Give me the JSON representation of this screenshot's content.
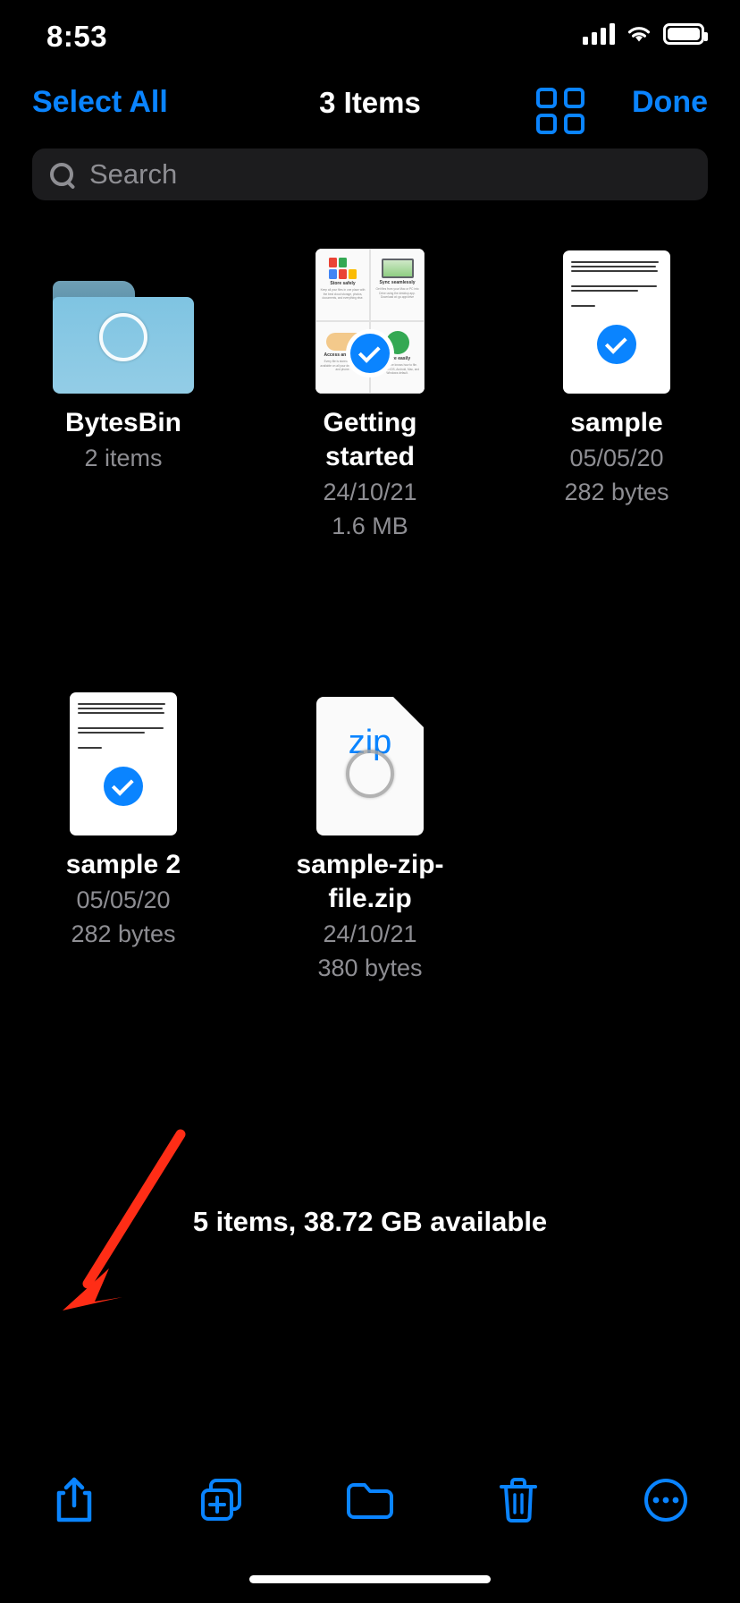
{
  "status_bar": {
    "time": "8:53",
    "cellular_icon": "signal-bars-icon",
    "wifi_icon": "wifi-icon",
    "battery_icon": "battery-icon"
  },
  "nav_bar": {
    "select_all_label": "Select All",
    "title": "3 Items",
    "grid_view_icon": "grid-view-icon",
    "done_label": "Done"
  },
  "search": {
    "placeholder": "Search",
    "value": "",
    "icon": "search-icon"
  },
  "files": [
    {
      "name": "BytesBin",
      "meta": [
        "2 items"
      ],
      "kind": "folder",
      "selected": false
    },
    {
      "name": "Getting started",
      "meta": [
        "24/10/21",
        "1.6 MB"
      ],
      "kind": "pdf",
      "selected": true,
      "preview": {
        "panels": [
          {
            "title": "Store safely",
            "subtitle": "Keep all your files in one place with the best cloud storage, photos, documents, and everything else."
          },
          {
            "title": "Sync seamlessly",
            "subtitle": "Get files from your Mac or PC into Drive using the desktop app. Download at: go.app/drive"
          },
          {
            "title": "Access anywhere",
            "subtitle": "Every file is stored online and available on all your devices, tablet, and phone."
          },
          {
            "title": "Share easily",
            "subtitle": "Then anyone knows how to file. Works with iOS, Android, Mac, and Windows default."
          }
        ]
      }
    },
    {
      "name": "sample",
      "meta": [
        "05/05/20",
        "282 bytes"
      ],
      "kind": "document",
      "selected": true
    },
    {
      "name": "sample 2",
      "meta": [
        "05/05/20",
        "282 bytes"
      ],
      "kind": "document",
      "selected": true
    },
    {
      "name": "sample-zip-file.zip",
      "meta": [
        "24/10/21",
        "380 bytes"
      ],
      "kind": "zip",
      "zip_label": "zip",
      "selected": false
    }
  ],
  "status_line": "5 items, 38.72 GB available",
  "toolbar": [
    {
      "name": "share-button",
      "icon": "share-icon"
    },
    {
      "name": "new-folder-button",
      "icon": "add-document-icon"
    },
    {
      "name": "folder-button",
      "icon": "folder-icon"
    },
    {
      "name": "delete-button",
      "icon": "trash-icon"
    },
    {
      "name": "more-button",
      "icon": "ellipsis-circle-icon"
    }
  ],
  "annotation": {
    "arrow_color": "#ff2d16",
    "points_to": "share-button"
  },
  "colors": {
    "accent_blue": "#0a84ff",
    "background": "#000000",
    "secondary_text": "#8e8e93",
    "search_field": "#1c1c1e"
  }
}
